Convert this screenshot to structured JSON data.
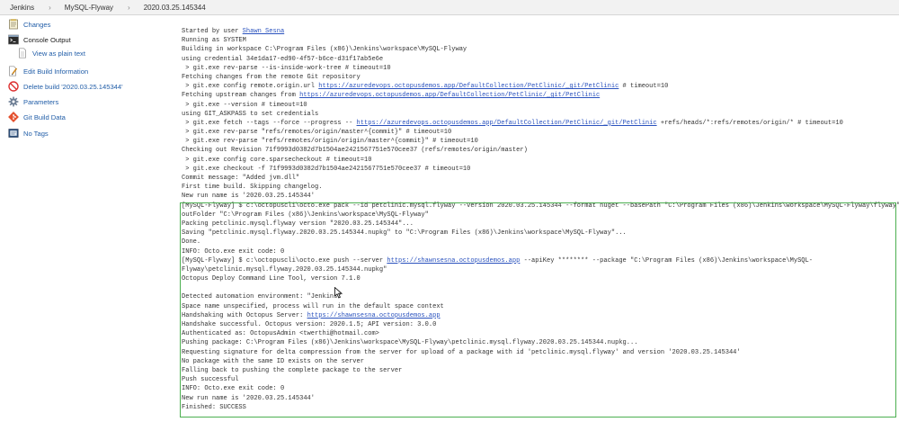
{
  "breadcrumb": {
    "items": [
      "Jenkins",
      "MySQL-Flyway",
      "2020.03.25.145344"
    ],
    "separator": "›"
  },
  "sidebar": {
    "items": [
      {
        "label": "Changes",
        "icon": "notepad-icon"
      },
      {
        "label": "Console Output",
        "icon": "terminal-icon",
        "active": true
      },
      {
        "label": "View as plain text",
        "icon": "document-icon"
      },
      {
        "label": "Edit Build Information",
        "icon": "edit-document-icon"
      },
      {
        "label": "Delete build '2020.03.25.145344'",
        "icon": "no-entry-icon"
      },
      {
        "label": "Parameters",
        "icon": "gear-icon"
      },
      {
        "label": "Git Build Data",
        "icon": "git-icon"
      },
      {
        "label": "No Tags",
        "icon": "tag-icon"
      }
    ]
  },
  "console": {
    "lines": [
      [
        {
          "t": "Started by user "
        },
        {
          "t": "Shawn Sesna",
          "link": true
        }
      ],
      [
        {
          "t": "Running as SYSTEM"
        }
      ],
      [
        {
          "t": "Building in workspace C:\\Program Files (x86)\\Jenkins\\workspace\\MySQL-Flyway"
        }
      ],
      [
        {
          "t": "using credential 34e1da17-ed90-4f57-b6ce-d31f17ab5e6e"
        }
      ],
      [
        {
          "t": " > git.exe rev-parse --is-inside-work-tree # timeout=10"
        }
      ],
      [
        {
          "t": "Fetching changes from the remote Git repository"
        }
      ],
      [
        {
          "t": " > git.exe config remote.origin.url "
        },
        {
          "t": "https://azuredevops.octopusdemos.app/DefaultCollection/PetClinic/_git/PetClinic",
          "link": true
        },
        {
          "t": " # timeout=10"
        }
      ],
      [
        {
          "t": "Fetching upstream changes from "
        },
        {
          "t": "https://azuredevops.octopusdemos.app/DefaultCollection/PetClinic/_git/PetClinic",
          "link": true
        }
      ],
      [
        {
          "t": " > git.exe --version # timeout=10"
        }
      ],
      [
        {
          "t": "using GIT_ASKPASS to set credentials"
        }
      ],
      [
        {
          "t": " > git.exe fetch --tags --force --progress -- "
        },
        {
          "t": "https://azuredevops.octopusdemos.app/DefaultCollection/PetClinic/_git/PetClinic",
          "link": true
        },
        {
          "t": " +refs/heads/*:refs/remotes/origin/* # timeout=10"
        }
      ],
      [
        {
          "t": " > git.exe rev-parse \"refs/remotes/origin/master^{commit}\" # timeout=10"
        }
      ],
      [
        {
          "t": " > git.exe rev-parse \"refs/remotes/origin/origin/master^{commit}\" # timeout=10"
        }
      ],
      [
        {
          "t": "Checking out Revision 71f9993d0382d7b1504ae2421567751e570cee37 (refs/remotes/origin/master)"
        }
      ],
      [
        {
          "t": " > git.exe config core.sparsecheckout # timeout=10"
        }
      ],
      [
        {
          "t": " > git.exe checkout -f 71f9993d0382d7b1504ae2421567751e570cee37 # timeout=10"
        }
      ],
      [
        {
          "t": "Commit message: \"Added jvm.dll\""
        }
      ],
      [
        {
          "t": "First time build. Skipping changelog."
        }
      ],
      [
        {
          "t": "New run name is '2020.03.25.145344'"
        }
      ],
      [
        {
          "t": "[MySQL-Flyway] $ c:\\octopuscli\\octo.exe pack --id petclinic.mysql.flyway --version 2020.03.25.145344 --format nuget --basePath \"C:\\Program Files (x86)\\Jenkins\\workspace\\MySQL-Flyway\\flyway\" --"
        }
      ],
      [
        {
          "t": "outFolder \"C:\\Program Files (x86)\\Jenkins\\workspace\\MySQL-Flyway\""
        }
      ],
      [
        {
          "t": "Packing petclinic.mysql.flyway version \"2020.03.25.145344\"..."
        }
      ],
      [
        {
          "t": "Saving \"petclinic.mysql.flyway.2020.03.25.145344.nupkg\" to \"C:\\Program Files (x86)\\Jenkins\\workspace\\MySQL-Flyway\"..."
        }
      ],
      [
        {
          "t": "Done."
        }
      ],
      [
        {
          "t": "INFO: Octo.exe exit code: 0"
        }
      ],
      [
        {
          "t": "[MySQL-Flyway] $ c:\\octopuscli\\octo.exe push --server "
        },
        {
          "t": "https://shawnsesna.octopusdemos.app",
          "link": true
        },
        {
          "t": " --apiKey ******** --package \"C:\\Program Files (x86)\\Jenkins\\workspace\\MySQL-"
        }
      ],
      [
        {
          "t": "Flyway\\petclinic.mysql.flyway.2020.03.25.145344.nupkg\""
        }
      ],
      [
        {
          "t": "Octopus Deploy Command Line Tool, version 7.1.0"
        }
      ],
      [
        {
          "t": ""
        }
      ],
      [
        {
          "t": "Detected automation environment: \"Jenkins\""
        }
      ],
      [
        {
          "t": "Space name unspecified, process will run in the default space context"
        }
      ],
      [
        {
          "t": "Handshaking with Octopus Server: "
        },
        {
          "t": "https://shawnsesna.octopusdemos.app",
          "link": true
        }
      ],
      [
        {
          "t": "Handshake successful. Octopus version: 2020.1.5; API version: 3.0.0"
        }
      ],
      [
        {
          "t": "Authenticated as: OctopusAdmin <twerthi@hotmail.com>"
        }
      ],
      [
        {
          "t": "Pushing package: C:\\Program Files (x86)\\Jenkins\\workspace\\MySQL-Flyway\\petclinic.mysql.flyway.2020.03.25.145344.nupkg..."
        }
      ],
      [
        {
          "t": "Requesting signature for delta compression from the server for upload of a package with id 'petclinic.mysql.flyway' and version '2020.03.25.145344'"
        }
      ],
      [
        {
          "t": "No package with the same ID exists on the server"
        }
      ],
      [
        {
          "t": "Falling back to pushing the complete package to the server"
        }
      ],
      [
        {
          "t": "Push successful"
        }
      ],
      [
        {
          "t": "INFO: Octo.exe exit code: 0"
        }
      ],
      [
        {
          "t": "New run name is '2020.03.25.145344'"
        }
      ],
      [
        {
          "t": "Finished: SUCCESS"
        }
      ]
    ]
  },
  "colors": {
    "link": "#2a52be",
    "highlight_border": "#4caf50",
    "breadcrumb_bg": "#f2f2f2"
  }
}
